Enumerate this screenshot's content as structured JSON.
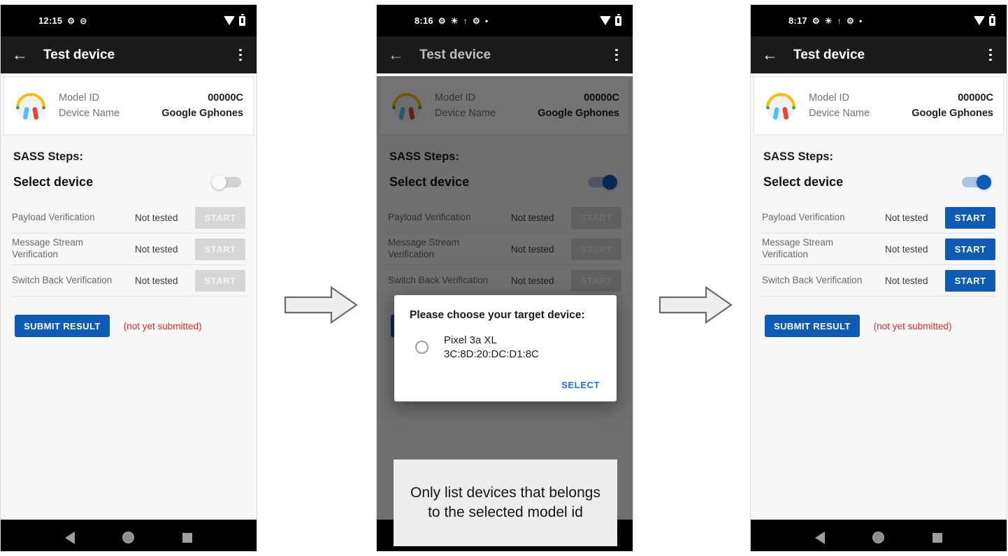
{
  "app": {
    "title": "Test device",
    "back_icon": "back-arrow-icon",
    "overflow_icon": "overflow-menu-icon"
  },
  "colors": {
    "accent_blue": "#0d5bb5",
    "link_blue": "#1a73e8",
    "error_red": "#e02b2b",
    "appbar_bg": "#1b1b1b",
    "disabled_gray": "#d6d6d6"
  },
  "panels": [
    {
      "id": "panel-initial",
      "status_bar": {
        "time": "12:15",
        "icons": [
          "android-debug-icon",
          "do-not-disturb-icon"
        ],
        "right_icons": [
          "wifi-icon",
          "battery-icon"
        ]
      },
      "toggle_on": false,
      "buttons_enabled": false,
      "scrim": false,
      "dialog": null,
      "callout": null
    },
    {
      "id": "panel-dialog",
      "status_bar": {
        "time": "8:16",
        "icons": [
          "android-debug-icon",
          "brightness-icon",
          "bluetooth-icon",
          "gear-icon",
          "dot-icon"
        ],
        "right_icons": [
          "wifi-icon",
          "battery-icon"
        ]
      },
      "toggle_on": true,
      "buttons_enabled": false,
      "scrim": true,
      "dialog": {
        "title": "Please choose your target device:",
        "option_name": "Pixel 3a XL",
        "option_mac": "3C:8D:20:DC:D1:8C",
        "select_label": "SELECT",
        "radio_selected": false
      },
      "callout": "Only list devices that belongs to the selected model id"
    },
    {
      "id": "panel-enabled",
      "status_bar": {
        "time": "8:17",
        "icons": [
          "android-debug-icon",
          "brightness-icon",
          "bluetooth-icon",
          "gear-icon",
          "dot-icon"
        ],
        "right_icons": [
          "wifi-icon",
          "battery-icon"
        ]
      },
      "toggle_on": true,
      "buttons_enabled": true,
      "scrim": false,
      "dialog": null,
      "callout": null
    }
  ],
  "device_card": {
    "icon": "headphones-icon",
    "rows": [
      {
        "key": "Model ID",
        "value": "00000C"
      },
      {
        "key": "Device Name",
        "value": "Google Gphones"
      }
    ]
  },
  "steps_section": {
    "heading": "SASS Steps:",
    "select_device_label": "Select device"
  },
  "tests": [
    {
      "name": "Payload Verification",
      "status": "Not tested",
      "action": "START"
    },
    {
      "name": "Message Stream Verification",
      "status": "Not tested",
      "action": "START"
    },
    {
      "name": "Switch Back Verification",
      "status": "Not tested",
      "action": "START"
    }
  ],
  "submit": {
    "label": "SUBMIT RESULT",
    "note": "(not yet submitted)"
  },
  "nav_bar": {
    "back": "nav-back-icon",
    "home": "nav-home-icon",
    "recents": "nav-recents-icon"
  },
  "flow_arrows": [
    {
      "name": "flow-arrow-1"
    },
    {
      "name": "flow-arrow-2"
    }
  ]
}
